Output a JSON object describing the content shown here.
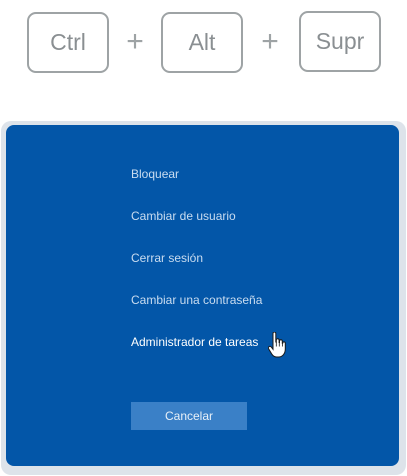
{
  "keys": {
    "ctrl": "Ctrl",
    "alt": "Alt",
    "supr": "Supr",
    "plus": "+"
  },
  "menu": {
    "items": [
      {
        "label": "Bloquear"
      },
      {
        "label": "Cambiar de usuario"
      },
      {
        "label": "Cerrar sesión"
      },
      {
        "label": "Cambiar una contraseña"
      },
      {
        "label": "Administrador de tareas"
      }
    ],
    "hovered_item": "Administrador de tareas"
  },
  "cancel_label": "Cancelar",
  "colors": {
    "panel_background": "#0356a8",
    "cancel_button": "#3a80c7",
    "key_border": "#9ea3a5"
  },
  "icons": {
    "cursor": "hand-pointer-icon"
  }
}
